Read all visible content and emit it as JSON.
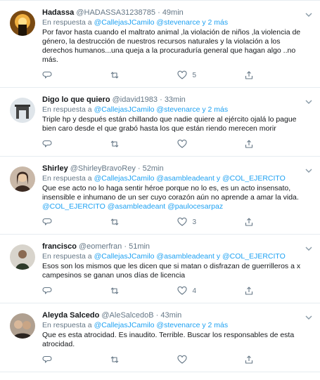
{
  "ui": {
    "reply_prefix": "En respuesta a",
    "and_word": "y",
    "link_color": "#1da1f2",
    "muted_color": "#657786"
  },
  "tweets": [
    {
      "name": "Hadassa",
      "handle": "@HADASSA31238785",
      "time": "49min",
      "reply_to": [
        "@CallejasJCamilo",
        "@stevenarce y 2 más"
      ],
      "text": "Por favor hasta cuando el maltrato animal ,la violación  de niños ,la violencia de género, la destrucción de nuestros recursos naturales y la violación  a los derechos humanos...una queja a la procuraduría general  que hagan algo ..no más.",
      "replies": "",
      "retweets": "",
      "likes": "5"
    },
    {
      "name": "Digo lo que quiero",
      "handle": "@idavid1983",
      "time": "33min",
      "reply_to": [
        "@CallejasJCamilo",
        "@stevenarce y 2 más"
      ],
      "text": "Triple hp y después están chillando que nadie quiere al ejército ojalá lo pague bien caro desde el que grabó hasta los que están riendo merecen morir",
      "replies": "",
      "retweets": "",
      "likes": ""
    },
    {
      "name": "Shirley",
      "handle": "@ShirleyBravoRey",
      "time": "52min",
      "reply_to": [
        "@CallejasJCamilo",
        "@asambleadeant",
        "@COL_EJERCITO"
      ],
      "text": "Que ese acto no lo haga sentir héroe porque no lo es, es un acto insensato, insensible e inhumano de un ser cuyo corazón aún no aprende a amar la vida.",
      "mentions": "@COL_EJERCITO @asambleadeant @paulocesarpaz",
      "replies": "",
      "retweets": "",
      "likes": "3"
    },
    {
      "name": "francisco",
      "handle": "@eomerfran",
      "time": "51min",
      "reply_to": [
        "@CallejasJCamilo",
        "@asambleadeant",
        "@COL_EJERCITO"
      ],
      "text": "Esos son los mismos que les dicen que si matan o disfrazan de guerrilleros a x campesinos se ganan unos días de licencia",
      "replies": "",
      "retweets": "",
      "likes": "4"
    },
    {
      "name": "Aleyda Salcedo",
      "handle": "@AleSalcedoB",
      "time": "43min",
      "reply_to": [
        "@CallejasJCamilo",
        "@stevenarce y 2 más"
      ],
      "text": "Que es esta atrocidad. Es inaudito. Terrible. Buscar los responsables de esta atrocidad.",
      "replies": "",
      "retweets": "",
      "likes": ""
    }
  ]
}
